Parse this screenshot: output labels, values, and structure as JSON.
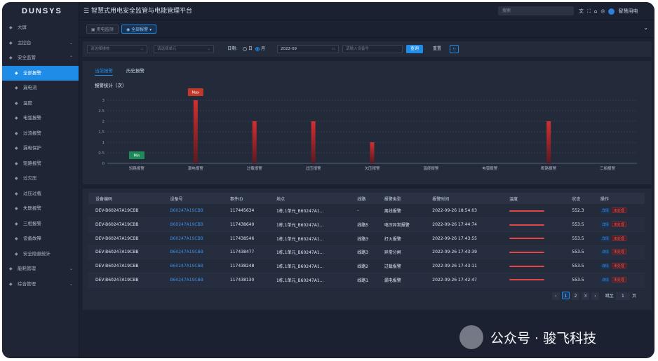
{
  "app": {
    "logo": "DUNSYS",
    "title": "智慧式用电安全监管与电能管理平台"
  },
  "topbar": {
    "search_placeholder": "搜索",
    "user": "智慧用电",
    "settings_label": "ᴅ"
  },
  "sidebar": {
    "items": [
      {
        "label": "大屏",
        "icon": "monitor-icon",
        "level": 0,
        "active": false,
        "chevron": ""
      },
      {
        "label": "主控台",
        "icon": "heart-icon",
        "level": 0,
        "active": false,
        "chevron": "⌄"
      },
      {
        "label": "安全监管",
        "icon": "shield-icon",
        "level": 0,
        "active": false,
        "chevron": "⌃"
      },
      {
        "label": "全部报警",
        "icon": "alarm-icon",
        "level": 1,
        "active": true,
        "chevron": ""
      },
      {
        "label": "漏电流",
        "icon": "leak-icon",
        "level": 1,
        "active": false,
        "chevron": ""
      },
      {
        "label": "温度",
        "icon": "temp-icon",
        "level": 1,
        "active": false,
        "chevron": ""
      },
      {
        "label": "电弧报警",
        "icon": "arc-icon",
        "level": 1,
        "active": false,
        "chevron": ""
      },
      {
        "label": "过流报警",
        "icon": "overcurrent-icon",
        "level": 1,
        "active": false,
        "chevron": ""
      },
      {
        "label": "漏电保护",
        "icon": "protect-icon",
        "level": 1,
        "active": false,
        "chevron": ""
      },
      {
        "label": "短路报警",
        "icon": "short-icon",
        "level": 1,
        "active": false,
        "chevron": ""
      },
      {
        "label": "过欠压",
        "icon": "voltage-icon",
        "level": 1,
        "active": false,
        "chevron": ""
      },
      {
        "label": "过压过载",
        "icon": "overload-icon",
        "level": 1,
        "active": false,
        "chevron": ""
      },
      {
        "label": "失联报警",
        "icon": "offline-icon",
        "level": 1,
        "active": false,
        "chevron": ""
      },
      {
        "label": "三相报警",
        "icon": "phase-icon",
        "level": 1,
        "active": false,
        "chevron": ""
      },
      {
        "label": "设备故障",
        "icon": "fault-icon",
        "level": 1,
        "active": false,
        "chevron": ""
      },
      {
        "label": "安全隐患统计",
        "icon": "stats-icon",
        "level": 1,
        "active": false,
        "chevron": ""
      },
      {
        "label": "能耗管理",
        "icon": "energy-icon",
        "level": 0,
        "active": false,
        "chevron": "⌄"
      },
      {
        "label": "综合管理",
        "icon": "manage-icon",
        "level": 0,
        "active": false,
        "chevron": "⌄"
      }
    ]
  },
  "tabs": [
    {
      "label": "用电监测",
      "active": false
    },
    {
      "label": "全部报警",
      "active": true
    }
  ],
  "filters": {
    "building_placeholder": "请选择楼栋",
    "unit_placeholder": "请选择单元",
    "date_label": "日期:",
    "day_label": "日",
    "month_label": "月",
    "month_value": "2022-09",
    "device_placeholder": "请输入设备号",
    "search_button": "查询",
    "reset_button": "重置"
  },
  "chart_tabs": [
    {
      "label": "当前报警",
      "active": true
    },
    {
      "label": "历史报警",
      "active": false
    }
  ],
  "chart_title": "报警统计（次）",
  "chart_data": {
    "type": "bar",
    "categories": [
      "短路报警",
      "漏电报警",
      "过载报警",
      "过压报警",
      "欠压报警",
      "温度报警",
      "电弧报警",
      "断路报警",
      "三相报警"
    ],
    "values": [
      0,
      3,
      2,
      2,
      1,
      0,
      0,
      2,
      0
    ],
    "ylim": [
      0,
      3
    ],
    "yticks": [
      0,
      0.5,
      1,
      1.5,
      2,
      2.5,
      3
    ],
    "grid": true,
    "markers": [
      {
        "category": "漏电报警",
        "label": "Max",
        "color": "#c0392b"
      },
      {
        "category": "短路报警",
        "label": "Min",
        "color": "#1e8a5a"
      }
    ]
  },
  "table": {
    "columns": [
      "设备编码",
      "设备号",
      "事件ID",
      "地点",
      "线路",
      "报警类型",
      "报警时间",
      "温度",
      "状态",
      "操作"
    ],
    "rows": [
      {
        "code": "DEV-B60247A19CBB",
        "device": "B60247A19CBB",
        "event": "117445634",
        "location": "1栋,1单元_B60247A1...",
        "line": "-",
        "type": "离线报警",
        "time": "2022-09-26 18:54:03",
        "status": "552.3",
        "view": "详情",
        "todo": "未处理"
      },
      {
        "code": "DEV-B60247A19CBB",
        "device": "B60247A19CBB",
        "event": "117438640",
        "location": "1栋,1单元_B60247A1...",
        "line": "线路5",
        "type": "电压异常报警",
        "time": "2022-09-26 17:44:74",
        "status": "553.5",
        "view": "详情",
        "todo": "未处理"
      },
      {
        "code": "DEV-B60247A19CBB",
        "device": "B60247A19CBB",
        "event": "117438546",
        "location": "1栋,1单元_B60247A1...",
        "line": "线路3",
        "type": "打火报警",
        "time": "2022-09-26 17:43:55",
        "status": "553.5",
        "view": "详情",
        "todo": "未处理"
      },
      {
        "code": "DEV-B60247A19CBB",
        "device": "B60247A19CBB",
        "event": "117438477",
        "location": "1栋,1单元_B60247A1...",
        "line": "线路3",
        "type": "异常分闸",
        "time": "2022-09-26 17:43:39",
        "status": "553.5",
        "view": "详情",
        "todo": "未处理"
      },
      {
        "code": "DEV-B60247A19CBB",
        "device": "B60247A19CBB",
        "event": "117438248",
        "location": "1栋,1单元_B60247A1...",
        "line": "线路2",
        "type": "过载报警",
        "time": "2022-09-26 17:43:11",
        "status": "553.5",
        "view": "详情",
        "todo": "未处理"
      },
      {
        "code": "DEV-B60247A19CBB",
        "device": "B60247A19CBB",
        "event": "117438130",
        "location": "1栋,1单元_B60247A1...",
        "line": "线路1",
        "type": "漏电报警",
        "time": "2022-09-26 17:42:47",
        "status": "553.5",
        "view": "详情",
        "todo": "未处理"
      }
    ]
  },
  "pagination": {
    "prev": "‹",
    "pages": [
      "1",
      "2",
      "3"
    ],
    "current": "1",
    "next": "›",
    "goto_label": "跳至",
    "goto_value": "1",
    "page_unit": "页"
  },
  "watermark": "公众号 · 骏飞科技",
  "colors": {
    "accent": "#1f8ce8",
    "bar": "#c62828",
    "danger": "#e04848",
    "background": "#1b2130"
  }
}
